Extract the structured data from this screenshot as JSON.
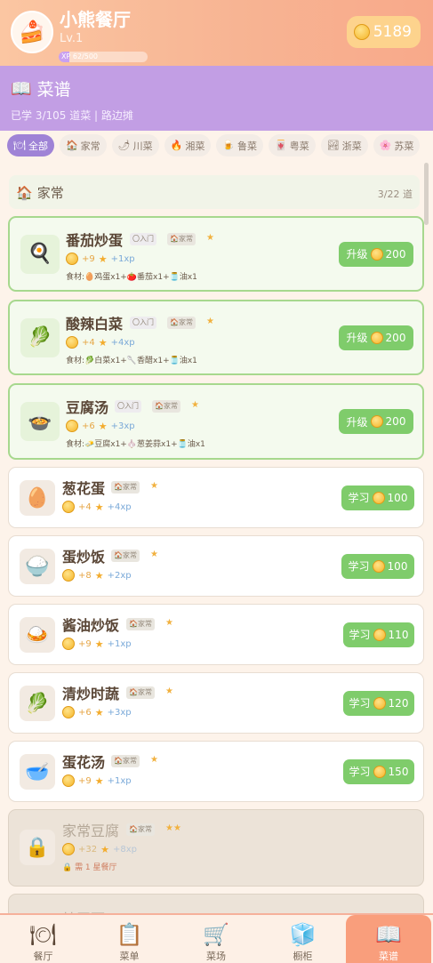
{
  "header": {
    "shop_name": "小熊餐厅",
    "level": "Lv.1",
    "xp_text": "XP 62/500",
    "xp_fraction": 0.124,
    "coins": "5189"
  },
  "banner": {
    "title": "菜谱",
    "subtitle": "已学 3/105 道菜 |   路边摊"
  },
  "filters": [
    {
      "label": "全部",
      "icon": "plate-icon",
      "active": true
    },
    {
      "label": "家常",
      "icon": "house-icon"
    },
    {
      "label": "川菜",
      "icon": "chili-icon"
    },
    {
      "label": "湘菜",
      "icon": "fire-icon"
    },
    {
      "label": "鲁菜",
      "icon": "beer-icon"
    },
    {
      "label": "粤菜",
      "icon": "dimsum-icon"
    },
    {
      "label": "浙菜",
      "icon": "landscape-icon"
    },
    {
      "label": "苏菜",
      "icon": "flower-icon"
    }
  ],
  "category": {
    "title": "家常",
    "count": "3/22 道"
  },
  "dishes": [
    {
      "name": "番茄炒蛋",
      "level_tag": "〇入门",
      "cat_tag": "家常",
      "stars": "★",
      "coin": "+9",
      "xp": "+1xp",
      "ingredients": "食材:🥚鸡蛋x1+🍅番茄x1+🫙油x1",
      "action": "升级",
      "price": "200",
      "state": "learned",
      "icon": "pan-icon",
      "glyph": "🍳"
    },
    {
      "name": "酸辣白菜",
      "level_tag": "〇入门",
      "cat_tag": "家常",
      "stars": "★",
      "coin": "+4",
      "xp": "+4xp",
      "ingredients": "食材:🥬白菜x1+🥄香醋x1+🫙油x1",
      "action": "升级",
      "price": "200",
      "state": "learned",
      "icon": "cabbage-icon",
      "glyph": "🥬"
    },
    {
      "name": "豆腐汤",
      "level_tag": "〇入门",
      "cat_tag": "家常",
      "stars": "★",
      "coin": "+6",
      "xp": "+3xp",
      "ingredients": "食材:🧈豆腐x1+🧄葱姜蒜x1+🫙油x1",
      "action": "升级",
      "price": "200",
      "state": "learned",
      "icon": "soup-icon",
      "glyph": "🍲"
    },
    {
      "name": "葱花蛋",
      "cat_tag": "家常",
      "stars": "★",
      "coin": "+4",
      "xp": "+4xp",
      "action": "学习",
      "price": "100",
      "state": "learnable",
      "icon": "egg-icon",
      "glyph": "🥚"
    },
    {
      "name": "蛋炒饭",
      "cat_tag": "家常",
      "stars": "★",
      "coin": "+8",
      "xp": "+2xp",
      "action": "学习",
      "price": "100",
      "state": "learnable",
      "icon": "rice-bowl-icon",
      "glyph": "🍚"
    },
    {
      "name": "酱油炒饭",
      "cat_tag": "家常",
      "stars": "★",
      "coin": "+9",
      "xp": "+1xp",
      "action": "学习",
      "price": "110",
      "state": "learnable",
      "icon": "curry-rice-icon",
      "glyph": "🍛"
    },
    {
      "name": "清炒时蔬",
      "cat_tag": "家常",
      "stars": "★",
      "coin": "+6",
      "xp": "+3xp",
      "action": "学习",
      "price": "120",
      "state": "learnable",
      "icon": "greens-icon",
      "glyph": "🥬"
    },
    {
      "name": "蛋花汤",
      "cat_tag": "家常",
      "stars": "★",
      "coin": "+9",
      "xp": "+1xp",
      "action": "学习",
      "price": "150",
      "state": "learnable",
      "icon": "soup-bowl-icon",
      "glyph": "🥣"
    },
    {
      "name": "家常豆腐",
      "cat_tag": "家常",
      "stars": "★★",
      "coin": "+32",
      "xp": "+8xp",
      "lock_note": "需 1 星餐厅",
      "state": "locked",
      "icon": "lock-icon",
      "glyph": "🔒"
    },
    {
      "name": "炒干面",
      "state": "locked-partial"
    }
  ],
  "nav": [
    {
      "label": "餐厅",
      "icon": "dining-icon",
      "glyph": "🍽"
    },
    {
      "label": "菜单",
      "icon": "clipboard-icon",
      "glyph": "📋"
    },
    {
      "label": "菜场",
      "icon": "cart-icon",
      "glyph": "🛒"
    },
    {
      "label": "橱柜",
      "icon": "ice-cabinet-icon",
      "glyph": "🧊"
    },
    {
      "label": "菜谱",
      "icon": "book-icon",
      "glyph": "📖",
      "active": true
    }
  ]
}
